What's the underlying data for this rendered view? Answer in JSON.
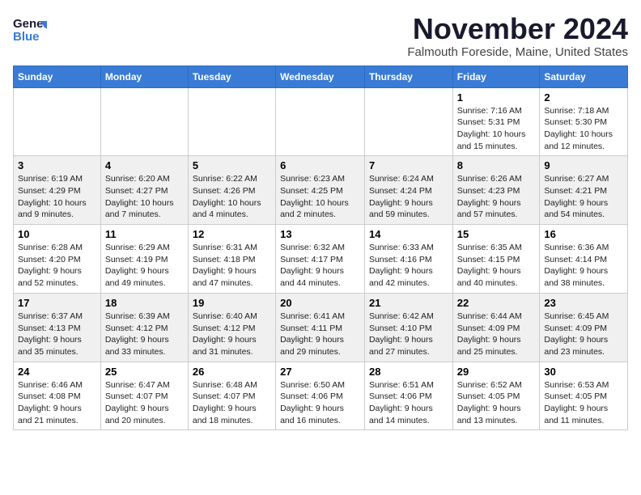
{
  "header": {
    "logo_general": "General",
    "logo_blue": "Blue",
    "month_title": "November 2024",
    "subtitle": "Falmouth Foreside, Maine, United States"
  },
  "weekdays": [
    "Sunday",
    "Monday",
    "Tuesday",
    "Wednesday",
    "Thursday",
    "Friday",
    "Saturday"
  ],
  "weeks": [
    [
      {
        "day": "",
        "sunrise": "",
        "sunset": "",
        "daylight": ""
      },
      {
        "day": "",
        "sunrise": "",
        "sunset": "",
        "daylight": ""
      },
      {
        "day": "",
        "sunrise": "",
        "sunset": "",
        "daylight": ""
      },
      {
        "day": "",
        "sunrise": "",
        "sunset": "",
        "daylight": ""
      },
      {
        "day": "",
        "sunrise": "",
        "sunset": "",
        "daylight": ""
      },
      {
        "day": "1",
        "sunrise": "Sunrise: 7:16 AM",
        "sunset": "Sunset: 5:31 PM",
        "daylight": "Daylight: 10 hours and 15 minutes."
      },
      {
        "day": "2",
        "sunrise": "Sunrise: 7:18 AM",
        "sunset": "Sunset: 5:30 PM",
        "daylight": "Daylight: 10 hours and 12 minutes."
      }
    ],
    [
      {
        "day": "3",
        "sunrise": "Sunrise: 6:19 AM",
        "sunset": "Sunset: 4:29 PM",
        "daylight": "Daylight: 10 hours and 9 minutes."
      },
      {
        "day": "4",
        "sunrise": "Sunrise: 6:20 AM",
        "sunset": "Sunset: 4:27 PM",
        "daylight": "Daylight: 10 hours and 7 minutes."
      },
      {
        "day": "5",
        "sunrise": "Sunrise: 6:22 AM",
        "sunset": "Sunset: 4:26 PM",
        "daylight": "Daylight: 10 hours and 4 minutes."
      },
      {
        "day": "6",
        "sunrise": "Sunrise: 6:23 AM",
        "sunset": "Sunset: 4:25 PM",
        "daylight": "Daylight: 10 hours and 2 minutes."
      },
      {
        "day": "7",
        "sunrise": "Sunrise: 6:24 AM",
        "sunset": "Sunset: 4:24 PM",
        "daylight": "Daylight: 9 hours and 59 minutes."
      },
      {
        "day": "8",
        "sunrise": "Sunrise: 6:26 AM",
        "sunset": "Sunset: 4:23 PM",
        "daylight": "Daylight: 9 hours and 57 minutes."
      },
      {
        "day": "9",
        "sunrise": "Sunrise: 6:27 AM",
        "sunset": "Sunset: 4:21 PM",
        "daylight": "Daylight: 9 hours and 54 minutes."
      }
    ],
    [
      {
        "day": "10",
        "sunrise": "Sunrise: 6:28 AM",
        "sunset": "Sunset: 4:20 PM",
        "daylight": "Daylight: 9 hours and 52 minutes."
      },
      {
        "day": "11",
        "sunrise": "Sunrise: 6:29 AM",
        "sunset": "Sunset: 4:19 PM",
        "daylight": "Daylight: 9 hours and 49 minutes."
      },
      {
        "day": "12",
        "sunrise": "Sunrise: 6:31 AM",
        "sunset": "Sunset: 4:18 PM",
        "daylight": "Daylight: 9 hours and 47 minutes."
      },
      {
        "day": "13",
        "sunrise": "Sunrise: 6:32 AM",
        "sunset": "Sunset: 4:17 PM",
        "daylight": "Daylight: 9 hours and 44 minutes."
      },
      {
        "day": "14",
        "sunrise": "Sunrise: 6:33 AM",
        "sunset": "Sunset: 4:16 PM",
        "daylight": "Daylight: 9 hours and 42 minutes."
      },
      {
        "day": "15",
        "sunrise": "Sunrise: 6:35 AM",
        "sunset": "Sunset: 4:15 PM",
        "daylight": "Daylight: 9 hours and 40 minutes."
      },
      {
        "day": "16",
        "sunrise": "Sunrise: 6:36 AM",
        "sunset": "Sunset: 4:14 PM",
        "daylight": "Daylight: 9 hours and 38 minutes."
      }
    ],
    [
      {
        "day": "17",
        "sunrise": "Sunrise: 6:37 AM",
        "sunset": "Sunset: 4:13 PM",
        "daylight": "Daylight: 9 hours and 35 minutes."
      },
      {
        "day": "18",
        "sunrise": "Sunrise: 6:39 AM",
        "sunset": "Sunset: 4:12 PM",
        "daylight": "Daylight: 9 hours and 33 minutes."
      },
      {
        "day": "19",
        "sunrise": "Sunrise: 6:40 AM",
        "sunset": "Sunset: 4:12 PM",
        "daylight": "Daylight: 9 hours and 31 minutes."
      },
      {
        "day": "20",
        "sunrise": "Sunrise: 6:41 AM",
        "sunset": "Sunset: 4:11 PM",
        "daylight": "Daylight: 9 hours and 29 minutes."
      },
      {
        "day": "21",
        "sunrise": "Sunrise: 6:42 AM",
        "sunset": "Sunset: 4:10 PM",
        "daylight": "Daylight: 9 hours and 27 minutes."
      },
      {
        "day": "22",
        "sunrise": "Sunrise: 6:44 AM",
        "sunset": "Sunset: 4:09 PM",
        "daylight": "Daylight: 9 hours and 25 minutes."
      },
      {
        "day": "23",
        "sunrise": "Sunrise: 6:45 AM",
        "sunset": "Sunset: 4:09 PM",
        "daylight": "Daylight: 9 hours and 23 minutes."
      }
    ],
    [
      {
        "day": "24",
        "sunrise": "Sunrise: 6:46 AM",
        "sunset": "Sunset: 4:08 PM",
        "daylight": "Daylight: 9 hours and 21 minutes."
      },
      {
        "day": "25",
        "sunrise": "Sunrise: 6:47 AM",
        "sunset": "Sunset: 4:07 PM",
        "daylight": "Daylight: 9 hours and 20 minutes."
      },
      {
        "day": "26",
        "sunrise": "Sunrise: 6:48 AM",
        "sunset": "Sunset: 4:07 PM",
        "daylight": "Daylight: 9 hours and 18 minutes."
      },
      {
        "day": "27",
        "sunrise": "Sunrise: 6:50 AM",
        "sunset": "Sunset: 4:06 PM",
        "daylight": "Daylight: 9 hours and 16 minutes."
      },
      {
        "day": "28",
        "sunrise": "Sunrise: 6:51 AM",
        "sunset": "Sunset: 4:06 PM",
        "daylight": "Daylight: 9 hours and 14 minutes."
      },
      {
        "day": "29",
        "sunrise": "Sunrise: 6:52 AM",
        "sunset": "Sunset: 4:05 PM",
        "daylight": "Daylight: 9 hours and 13 minutes."
      },
      {
        "day": "30",
        "sunrise": "Sunrise: 6:53 AM",
        "sunset": "Sunset: 4:05 PM",
        "daylight": "Daylight: 9 hours and 11 minutes."
      }
    ]
  ]
}
